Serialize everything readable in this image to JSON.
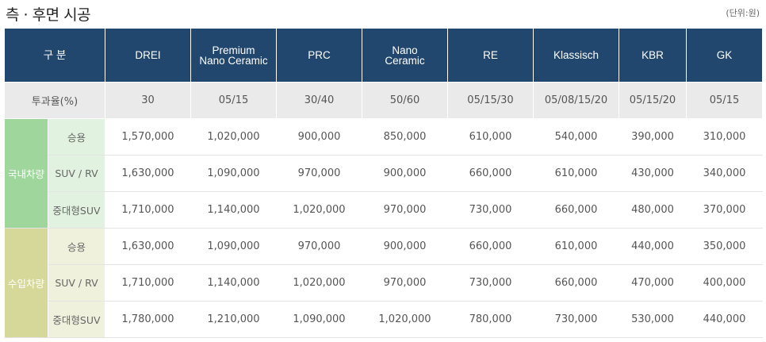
{
  "title": "측 · 후면 시공",
  "unit": "(단위:원)",
  "header": {
    "category": "구 분",
    "products": [
      {
        "line1": "DREI",
        "line2": ""
      },
      {
        "line1": "Premium",
        "line2": "Nano Ceramic"
      },
      {
        "line1": "PRC",
        "line2": ""
      },
      {
        "line1": "Nano",
        "line2": "Ceramic"
      },
      {
        "line1": "RE",
        "line2": ""
      },
      {
        "line1": "Klassisch",
        "line2": ""
      },
      {
        "line1": "KBR",
        "line2": ""
      },
      {
        "line1": "GK",
        "line2": ""
      }
    ]
  },
  "transmittance": {
    "label": "투과율(%)",
    "values": [
      "30",
      "05/15",
      "30/40",
      "50/60",
      "05/15/30",
      "05/08/15/20",
      "05/15/20",
      "05/15"
    ]
  },
  "groups": [
    {
      "name": "국내차량",
      "color": "#9ed69b",
      "rows": [
        {
          "type": "승용",
          "prices": [
            "1,570,000",
            "1,020,000",
            "900,000",
            "850,000",
            "610,000",
            "540,000",
            "390,000",
            "310,000"
          ]
        },
        {
          "type": "SUV / RV",
          "prices": [
            "1,630,000",
            "1,090,000",
            "970,000",
            "900,000",
            "660,000",
            "610,000",
            "430,000",
            "340,000"
          ]
        },
        {
          "type": "중대형SUV",
          "prices": [
            "1,710,000",
            "1,140,000",
            "1,020,000",
            "970,000",
            "730,000",
            "660,000",
            "480,000",
            "370,000"
          ]
        }
      ]
    },
    {
      "name": "수입차량",
      "color": "#d6d89a",
      "rows": [
        {
          "type": "승용",
          "prices": [
            "1,630,000",
            "1,090,000",
            "970,000",
            "900,000",
            "660,000",
            "610,000",
            "440,000",
            "350,000"
          ]
        },
        {
          "type": "SUV / RV",
          "prices": [
            "1,710,000",
            "1,140,000",
            "1,020,000",
            "970,000",
            "730,000",
            "660,000",
            "470,000",
            "400,000"
          ]
        },
        {
          "type": "중대형SUV",
          "prices": [
            "1,780,000",
            "1,210,000",
            "1,090,000",
            "1,020,000",
            "780,000",
            "730,000",
            "530,000",
            "440,000"
          ]
        }
      ]
    }
  ],
  "colors": {
    "header_bg": "#22476e",
    "rate_bg": "#eaeaea"
  }
}
